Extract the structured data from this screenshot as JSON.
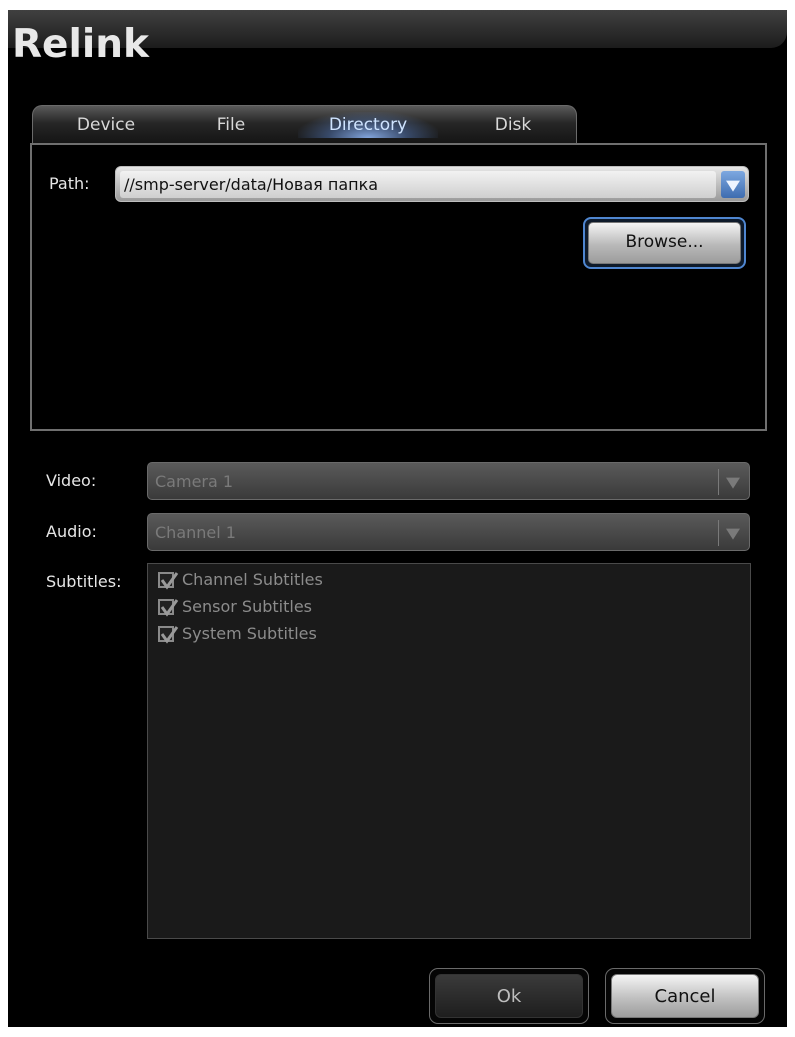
{
  "window": {
    "title": "Relink"
  },
  "tabs": [
    {
      "label": "Device",
      "active": false
    },
    {
      "label": "File",
      "active": false
    },
    {
      "label": "Directory",
      "active": true
    },
    {
      "label": "Disk",
      "active": false
    }
  ],
  "directory": {
    "path_label": "Path:",
    "path_value": "//smp-server/data/Новая папка",
    "browse_label": "Browse..."
  },
  "video": {
    "label": "Video:",
    "value": "Camera 1",
    "enabled": false
  },
  "audio": {
    "label": "Audio:",
    "value": "Channel 1",
    "enabled": false
  },
  "subtitles": {
    "label": "Subtitles:",
    "items": [
      {
        "label": "Channel Subtitles",
        "checked": true
      },
      {
        "label": "Sensor Subtitles",
        "checked": true
      },
      {
        "label": "System Subtitles",
        "checked": true
      }
    ]
  },
  "buttons": {
    "ok_label": "Ok",
    "cancel_label": "Cancel"
  },
  "colors": {
    "accent": "#4f86d0",
    "background": "#000000",
    "disabled_text": "#7a7a7a"
  }
}
